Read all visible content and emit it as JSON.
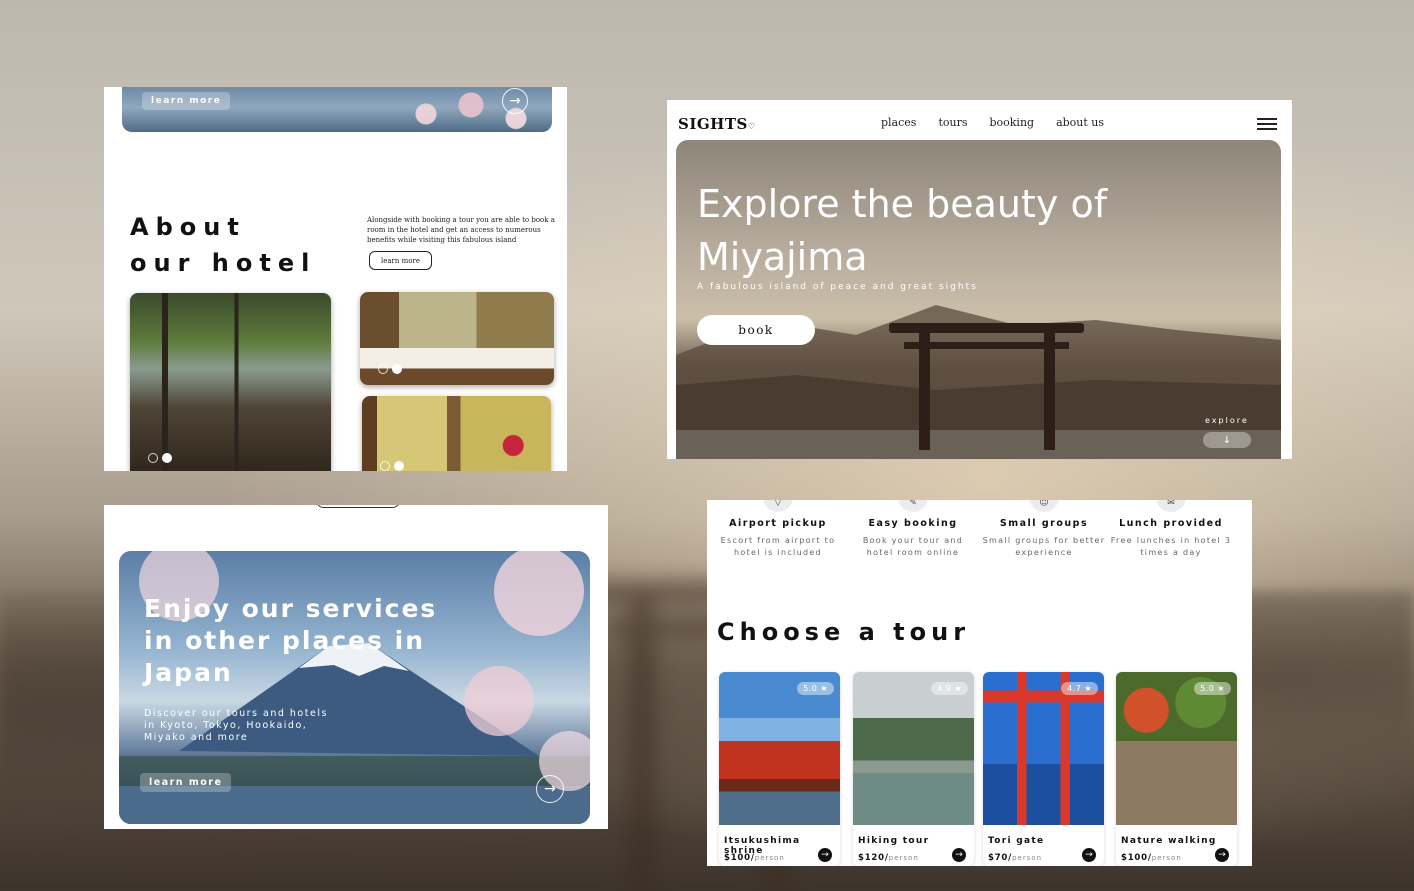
{
  "about": {
    "strip_learn_more": "learn more",
    "strip_arrow": "→",
    "title": "About\nour hotel",
    "text": "Alongside with booking a tour you are able to book a room in the hotel and get an access to numerous benefits while visiting this fabulous island",
    "learn_more": "learn more"
  },
  "hero": {
    "logo": "SIGHTS",
    "logo_heart": "♡",
    "nav": [
      "places",
      "tours",
      "booking",
      "about us"
    ],
    "title": "Explore the beauty of Miyajima",
    "subtitle": "A fabulous island of peace and great sights",
    "book": "book",
    "explore": "explore",
    "explore_arrow": "↓"
  },
  "services": {
    "title": "Enjoy our services in other places in Japan",
    "subtitle": "Discover our tours and hotels in Kyoto, Tokyo, Hookaido, Miyako and more",
    "learn_more": "learn more",
    "arrow": "→"
  },
  "tours": {
    "features": [
      {
        "icon": "▽",
        "title": "Airport pickup",
        "desc": "Escort from airport to hotel is included"
      },
      {
        "icon": "✎",
        "title": "Easy booking",
        "desc": "Book your tour and hotel room online"
      },
      {
        "icon": "☺",
        "title": "Small groups",
        "desc": "Small groups for better experience"
      },
      {
        "icon": "✉",
        "title": "Lunch provided",
        "desc": "Free lunches in hotel 3 times a day"
      }
    ],
    "heading": "Choose a tour",
    "cards": [
      {
        "name": "Itsukushima shrine",
        "price": "$100/",
        "per": "person",
        "rating": "5.0 ★",
        "go": "→"
      },
      {
        "name": "Hiking tour",
        "price": "$120/",
        "per": "person",
        "rating": "4.9 ★",
        "go": "→"
      },
      {
        "name": "Tori gate",
        "price": "$70/",
        "per": "person",
        "rating": "4.7 ★",
        "go": "→"
      },
      {
        "name": "Nature walking",
        "price": "$100/",
        "per": "person",
        "rating": "5.0 ★",
        "go": "→"
      }
    ]
  },
  "colors": {
    "accent_dark": "#111111",
    "background_warm": "#cfc7b9"
  }
}
